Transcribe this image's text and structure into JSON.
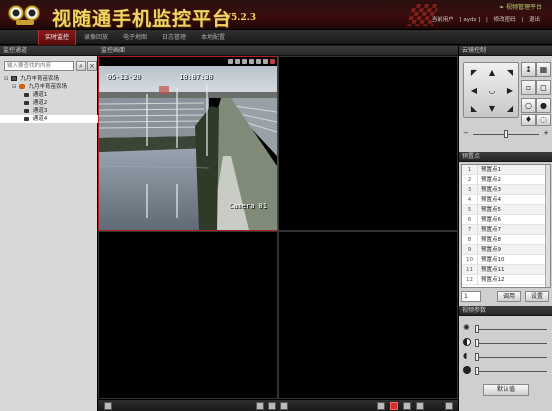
{
  "header": {
    "title": "视随通手机监控平台",
    "version": "V5.2.3",
    "help_link": "视频管理平台",
    "user_label": "当前用户",
    "username": "[ ayds ]",
    "change_password": "修改密码",
    "logout": "退出"
  },
  "nav": {
    "items": [
      {
        "label": "实时监控",
        "active": true
      },
      {
        "label": "录像回放",
        "active": false
      },
      {
        "label": "电子地图",
        "active": false
      },
      {
        "label": "日志管理",
        "active": false
      },
      {
        "label": "本地配置",
        "active": false
      }
    ]
  },
  "left": {
    "title": "监控通道",
    "search_placeholder": "输入要查找的内容",
    "tree": {
      "root": "九月丰育苗农场",
      "org": "九月丰育苗农场",
      "channels": [
        "通道1",
        "通道2",
        "通道3",
        "通道4"
      ],
      "selected_index": 3
    }
  },
  "center": {
    "title": "监控画面",
    "osd_date": "05-13-20",
    "osd_time": "10:07:30",
    "osd_camera": "Camera 01"
  },
  "right": {
    "ptz_title": "云镜控制",
    "speed_level": 0.5,
    "preset_title": "预置点",
    "presets": [
      {
        "num": "1",
        "name": "预置点1"
      },
      {
        "num": "2",
        "name": "预置点2"
      },
      {
        "num": "3",
        "name": "预置点3"
      },
      {
        "num": "4",
        "name": "预置点4"
      },
      {
        "num": "5",
        "name": "预置点5"
      },
      {
        "num": "6",
        "name": "预置点6"
      },
      {
        "num": "7",
        "name": "预置点7"
      },
      {
        "num": "8",
        "name": "预置点8"
      },
      {
        "num": "9",
        "name": "预置点9"
      },
      {
        "num": "10",
        "name": "预置点10"
      },
      {
        "num": "11",
        "name": "预置点11"
      },
      {
        "num": "12",
        "name": "预置点12"
      }
    ],
    "preset_number": "1",
    "call_button": "调用",
    "set_button": "设置",
    "video_params_title": "视频参数",
    "default_button": "默认值"
  },
  "colors": {
    "accent": "#b02020",
    "title_gold": "#f2d463"
  }
}
